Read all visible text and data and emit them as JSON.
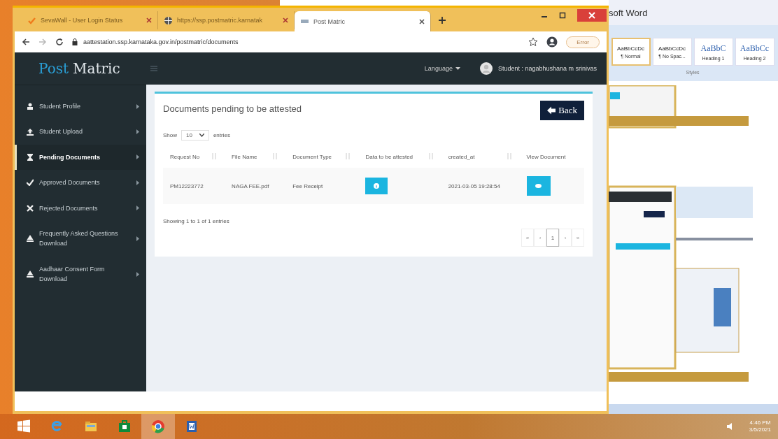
{
  "word_window": {
    "title": "soft Word",
    "styles": [
      {
        "preview": "AaBbCcDc",
        "name": "¶ Normal",
        "selected": true
      },
      {
        "preview": "AaBbCcDc",
        "name": "¶ No Spac...",
        "selected": false
      },
      {
        "preview": "AaBbC",
        "name": "Heading 1",
        "selected": false
      },
      {
        "preview": "AaBbCc",
        "name": "Heading 2",
        "selected": false
      }
    ],
    "group_label": "Styles"
  },
  "browser": {
    "tabs": [
      {
        "kind": "check",
        "title": "SevaWall - User Login Status",
        "selected": false
      },
      {
        "kind": "globe",
        "title": "https://ssp.postmatric.karnatak",
        "selected": false
      },
      {
        "kind": "page",
        "title": "Post Matric",
        "selected": true
      }
    ],
    "url": "aattestation.ssp.karnataka.gov.in/postmatric/documents",
    "profile_button": "Error"
  },
  "app": {
    "logo": [
      "Post",
      "Matric"
    ],
    "language": "Language",
    "user": "Student : nagabhushana m srinivas",
    "sidebar": {
      "items": [
        {
          "kind": "profile",
          "label": "Student Profile",
          "selected": false
        },
        {
          "kind": "upload",
          "label": "Student Upload",
          "selected": false
        },
        {
          "kind": "pending",
          "label": "Pending Documents",
          "selected": true
        },
        {
          "kind": "approved",
          "label": "Approved Documents",
          "selected": false
        },
        {
          "kind": "rejected",
          "label": "Rejected Documents",
          "selected": false
        },
        {
          "kind": "download",
          "label": "Frequently Asked Questions Download",
          "selected": false
        },
        {
          "kind": "download",
          "label": "Aadhaar Consent Form Download",
          "selected": false
        }
      ]
    },
    "card": {
      "title": "Documents pending to be attested",
      "back_button": "Back",
      "length": {
        "before": "Show",
        "value": "10",
        "after": "entries"
      },
      "table": {
        "columns": [
          {
            "label": "Request No",
            "sortable": true
          },
          {
            "label": "File Name",
            "sortable": true
          },
          {
            "label": "Document Type",
            "sortable": true
          },
          {
            "label": "Data to be attested",
            "sortable": true
          },
          {
            "label": "created_at",
            "sortable": true
          },
          {
            "label": "View Document",
            "sortable": false
          }
        ],
        "rows": [
          [
            {
              "kind": "text",
              "text": "PM12223772"
            },
            {
              "kind": "text",
              "text": "NAGA FEE.pdf"
            },
            {
              "kind": "text",
              "text": "Fee Receipt"
            },
            {
              "kind": "info"
            },
            {
              "kind": "text",
              "text": "2021-03-05 19:28:54"
            },
            {
              "kind": "view"
            }
          ]
        ]
      },
      "info": "Showing 1 to 1 of 1 entries",
      "pagination": [
        {
          "label": "«",
          "selected": false
        },
        {
          "label": "‹",
          "selected": false
        },
        {
          "label": "1",
          "selected": true
        },
        {
          "label": "›",
          "selected": false
        },
        {
          "label": "»",
          "selected": false
        }
      ]
    }
  },
  "taskbar": {
    "apps": [
      {
        "kind": "start",
        "selected": false
      },
      {
        "kind": "ie",
        "selected": false
      },
      {
        "kind": "explorer",
        "selected": false
      },
      {
        "kind": "store",
        "selected": false
      },
      {
        "kind": "chrome",
        "selected": true
      },
      {
        "kind": "word",
        "selected": false
      }
    ],
    "time": "4:46 PM",
    "date": "3/5/2021"
  }
}
